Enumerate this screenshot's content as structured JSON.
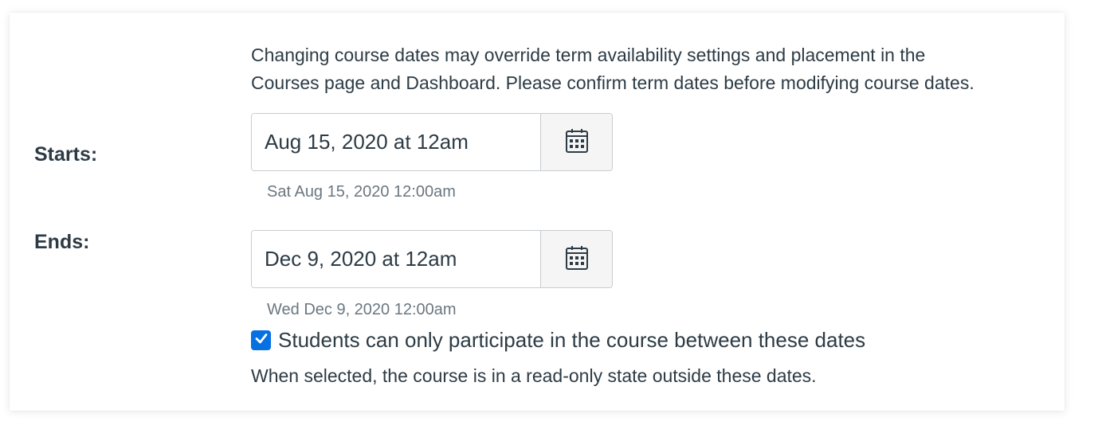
{
  "notice": {
    "line1": "Changing course dates may override term availability settings and placement in the",
    "line2": "Courses page and Dashboard. Please confirm term dates before modifying course dates."
  },
  "start": {
    "label": "Starts:",
    "value": "Aug 15, 2020 at 12am",
    "hint": "Sat Aug 15, 2020 12:00am",
    "calendar_icon": "calendar-icon"
  },
  "end": {
    "label": "Ends:",
    "value": "Dec 9, 2020 at 12am",
    "hint": "Wed Dec 9, 2020 12:00am",
    "calendar_icon": "calendar-icon"
  },
  "restrict": {
    "checked": true,
    "label": "Students can only participate in the course between these dates",
    "subtext": "When selected, the course is in a read-only state outside these dates."
  },
  "colors": {
    "text": "#2d3b45",
    "hint": "#6b7780",
    "checkbox": "#0770e3",
    "border": "#c7cdd1"
  }
}
